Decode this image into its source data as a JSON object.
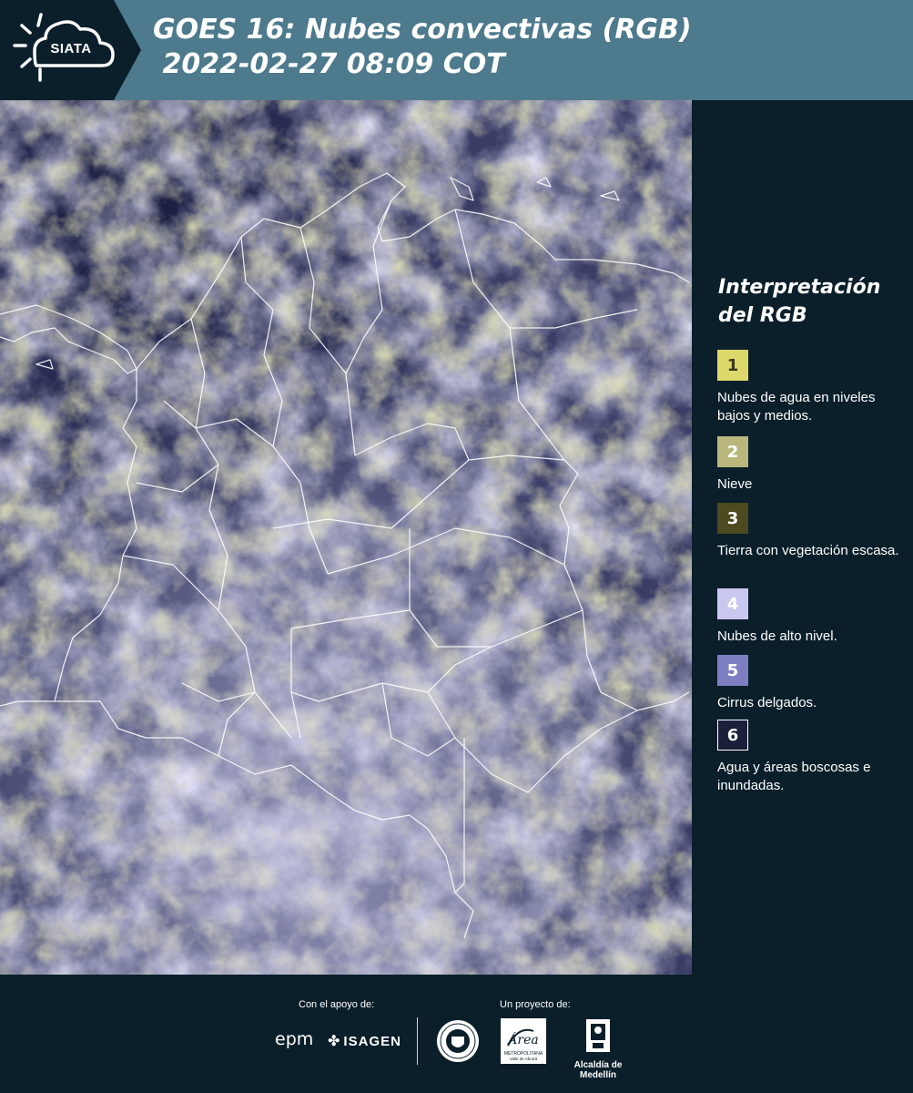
{
  "header": {
    "logo_text": "SIATA",
    "title": "GOES 16: Nubes convectivas (RGB)\n 2022-02-27 08:09 COT",
    "colors": {
      "background": "#4d7a8c",
      "logo_background": "#0b1f2b"
    }
  },
  "legend": {
    "title": "Interpretación del RGB",
    "items": [
      {
        "number": "1",
        "label": "Nubes de agua en niveles bajos y medios.",
        "color": "#dcd86a",
        "text_color": "#3b3a1a"
      },
      {
        "number": "2",
        "label": "Nieve",
        "color": "#b9b77c",
        "text_color": "#ffffff"
      },
      {
        "number": "3",
        "label": "Tierra con vegetación escasa.",
        "color": "#4c4a1e",
        "text_color": "#ffffff"
      },
      {
        "number": "4",
        "label": "Nubes de alto nivel.",
        "color": "#c8c8f0",
        "text_color": "#ffffff"
      },
      {
        "number": "5",
        "label": "Cirrus delgados.",
        "color": "#7d7fc2",
        "text_color": "#ffffff"
      },
      {
        "number": "6",
        "label": "Agua y áreas boscosas e inundadas.",
        "color": "#1a1f3a",
        "text_color": "#ffffff"
      }
    ]
  },
  "footer": {
    "support_label": "Con el apoyo de:",
    "project_label": "Un proyecto de:",
    "sponsors": [
      "epm",
      "ISAGEN"
    ],
    "partners": {
      "area_name": "Área",
      "area_line2": "METROPOLITANA",
      "area_line3": "Valle de Aburrá",
      "alcaldia": "Alcaldía de Medellín"
    }
  },
  "map": {
    "base_color": "#3a3d66",
    "cloud_colors": [
      "#c9caf0",
      "#a9abdc",
      "#b6b67a",
      "#8a8a5a"
    ],
    "border_color": "#ffffff"
  }
}
